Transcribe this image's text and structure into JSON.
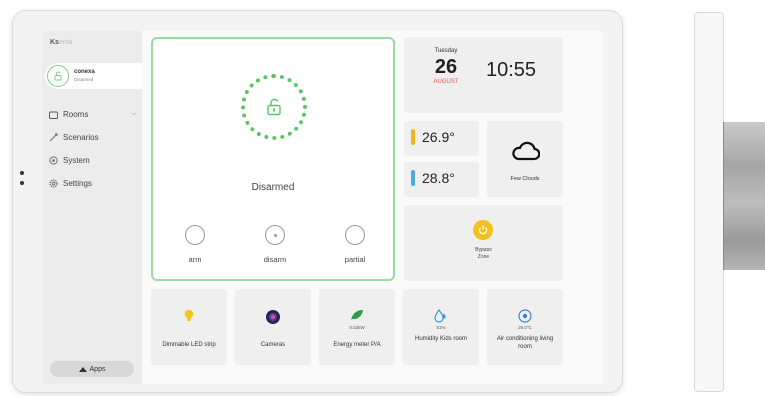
{
  "brand": {
    "name": "Ksenia",
    "name_dark": "Ks",
    "name_accent": "enia"
  },
  "profile": {
    "name": "conexa",
    "status": "Disarmed"
  },
  "nav": [
    {
      "label": "Rooms",
      "icon": "folder-icon",
      "expandable": true
    },
    {
      "label": "Scenarios",
      "icon": "scenario-icon"
    },
    {
      "label": "System",
      "icon": "system-icon"
    },
    {
      "label": "Settings",
      "icon": "gear-icon"
    }
  ],
  "apps": {
    "label": "Apps"
  },
  "alarm": {
    "status": "Disarmed",
    "options": [
      {
        "label": "arm",
        "selected": false
      },
      {
        "label": "disarm",
        "selected": true
      },
      {
        "label": "partial",
        "selected": false
      }
    ]
  },
  "datetime": {
    "weekday": "Tuesday",
    "day": "26",
    "month": "AUGUST",
    "time": "10:55"
  },
  "temperatures": [
    {
      "value": "26.9°",
      "color": "#f1b419"
    },
    {
      "value": "28.8°",
      "color": "#4aa9e6"
    }
  ],
  "weather": {
    "label": "Few Clouds",
    "icon": "cloud-icon"
  },
  "zone": {
    "line1": "Bypass",
    "line2": "Zone",
    "icon": "power-icon"
  },
  "devices": [
    {
      "label": "Dimmable LED strip",
      "value": "",
      "icon": "bulb-icon"
    },
    {
      "label": "Cameras",
      "value": "",
      "icon": "camera-icon"
    },
    {
      "label": "Energy meter P/A",
      "value": "0.02kW",
      "icon": "leaf-icon"
    },
    {
      "label": "Humidity Kids room",
      "value": "51%",
      "icon": "drops-icon"
    },
    {
      "label": "Air conditioning living room",
      "value": "26.0°C",
      "icon": "aircon-icon"
    }
  ],
  "colors": {
    "accent_green": "#5ac567",
    "alarm_border": "#9bdba1",
    "date_red": "#e4574b",
    "zone_yellow": "#f3c21a"
  }
}
